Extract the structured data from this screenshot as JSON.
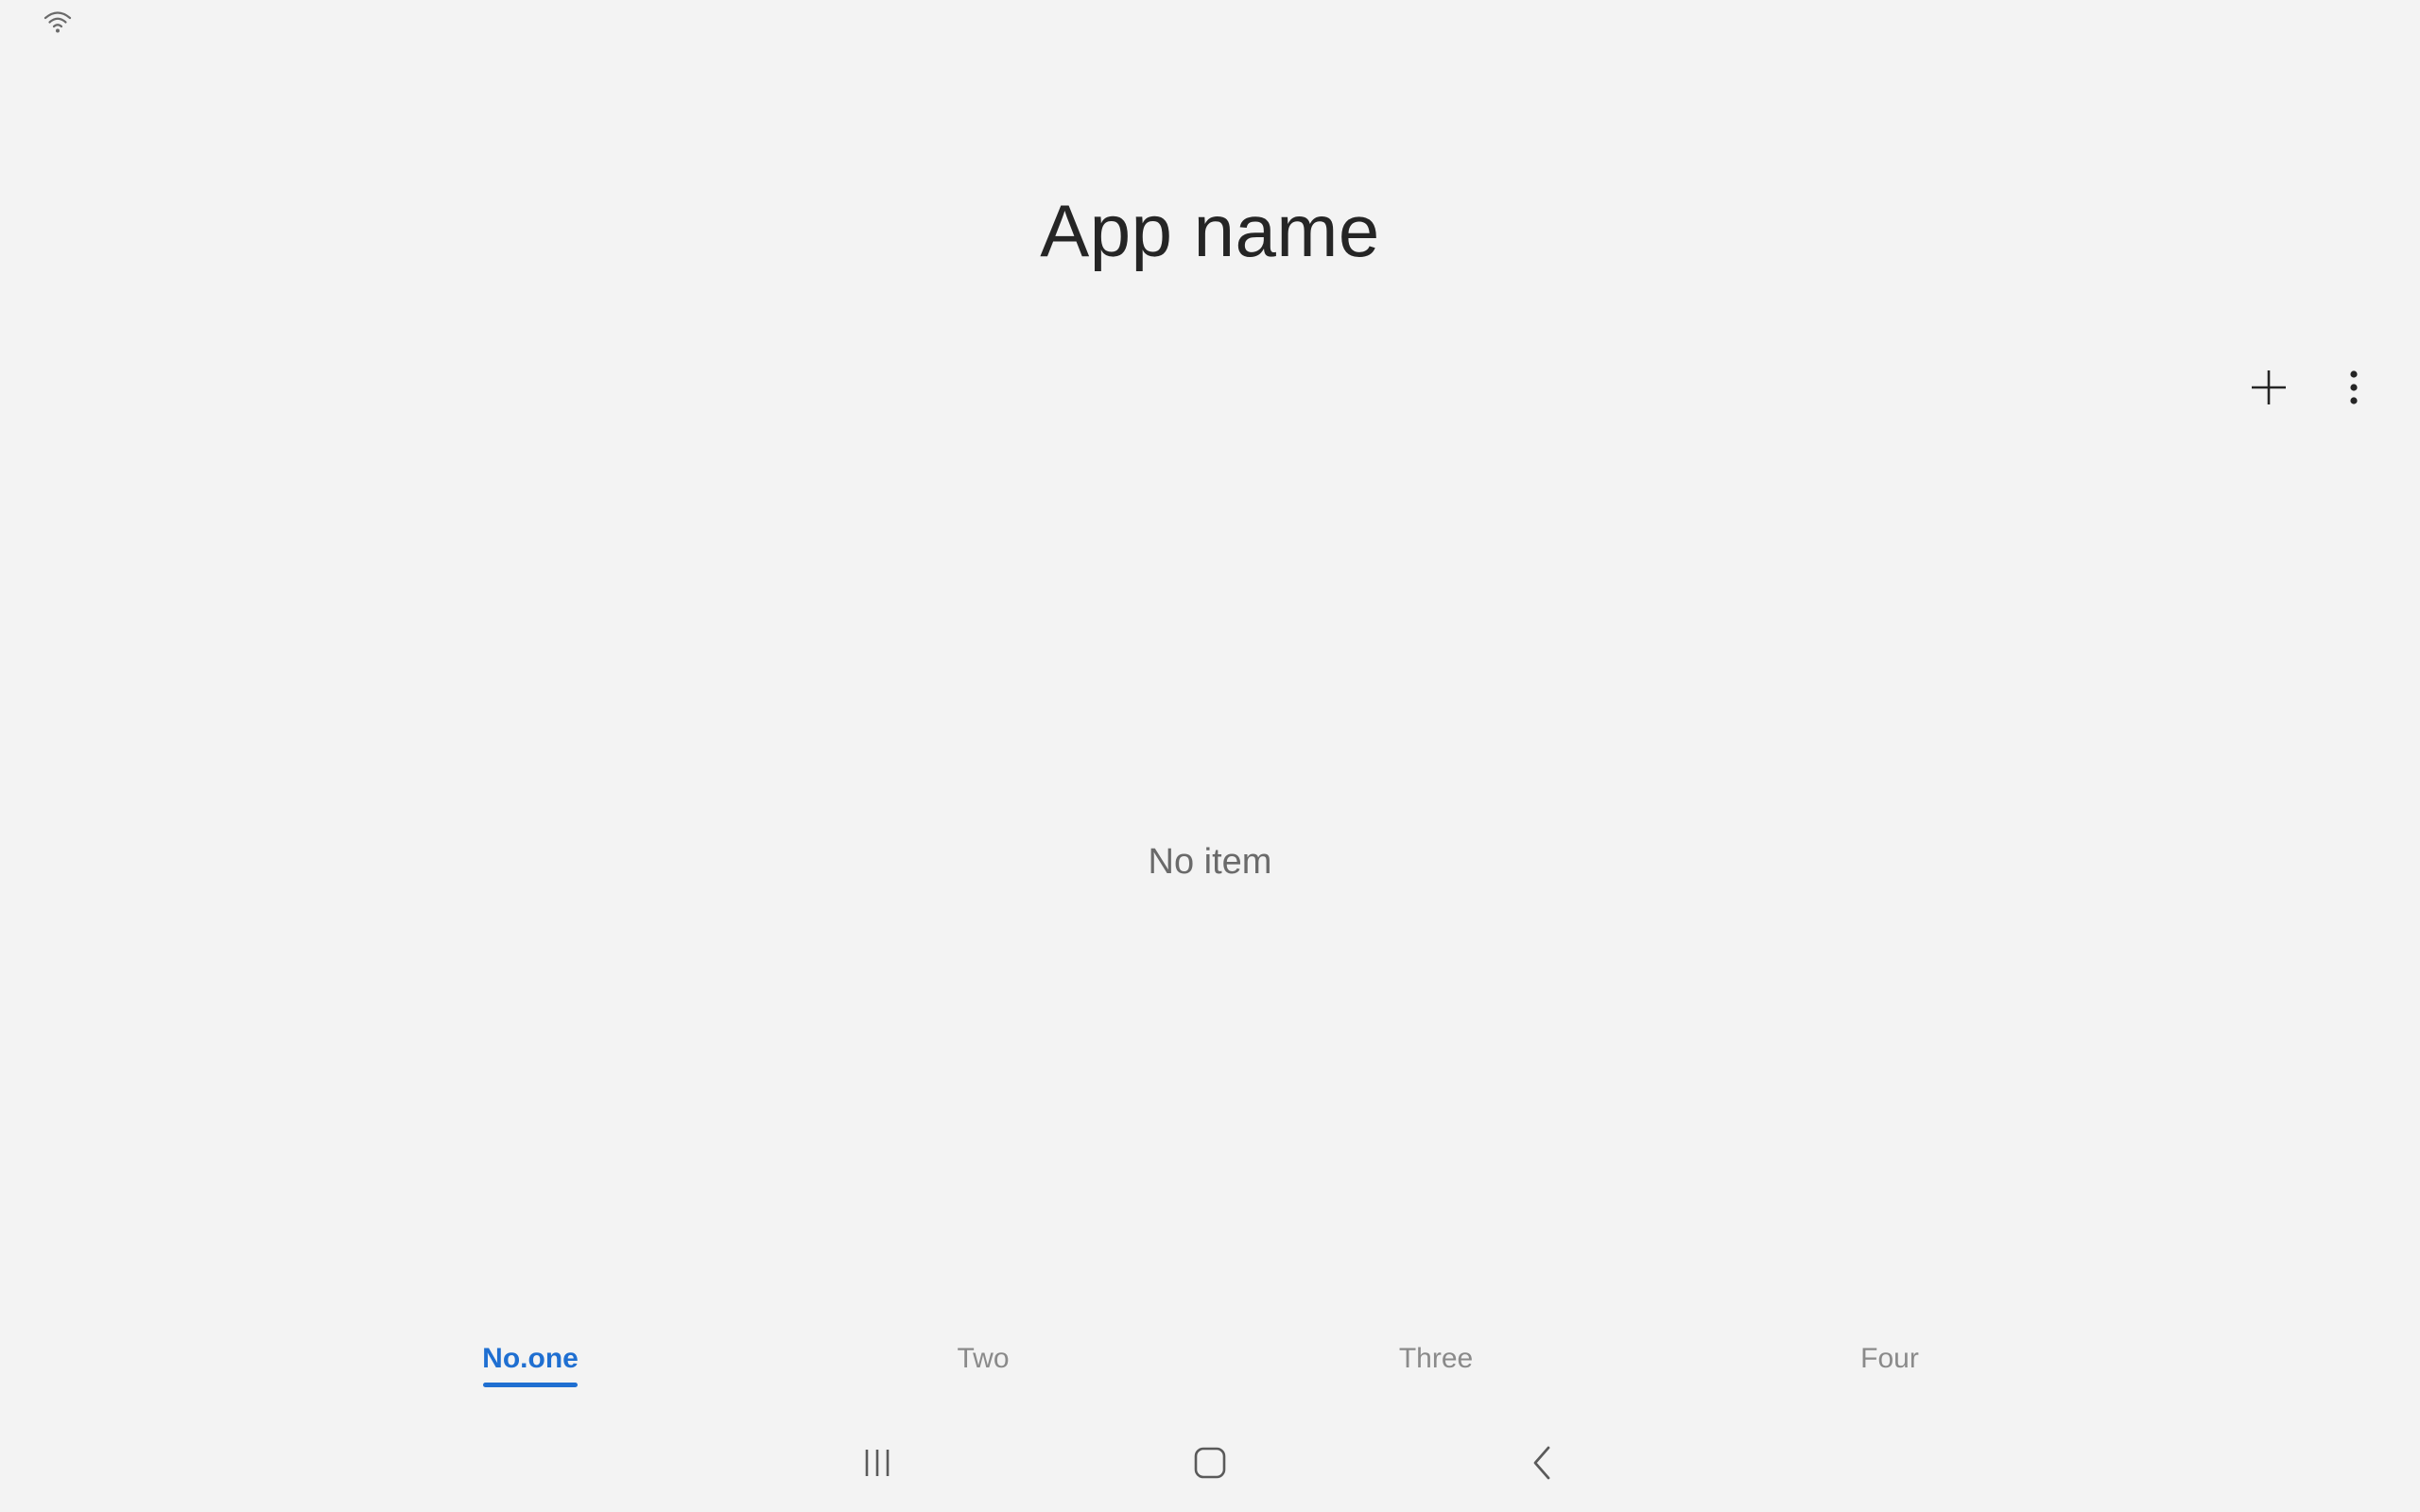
{
  "status_bar": {
    "wifi_icon": "wifi-icon"
  },
  "header": {
    "title": "App name"
  },
  "toolbar": {
    "add_icon": "plus-icon",
    "more_icon": "more-vertical-icon"
  },
  "main": {
    "empty_text": "No item"
  },
  "tabs": [
    {
      "label": "No.one",
      "active": true
    },
    {
      "label": "Two",
      "active": false
    },
    {
      "label": "Three",
      "active": false
    },
    {
      "label": "Four",
      "active": false
    }
  ],
  "nav_bar": {
    "recents_icon": "recents-icon",
    "home_icon": "home-icon",
    "back_icon": "back-icon"
  },
  "colors": {
    "background": "#f3f3f3",
    "accent": "#1f6fd1",
    "text_primary": "#252525",
    "text_secondary": "#6a6a6a",
    "tab_inactive": "#8a8a8a"
  }
}
